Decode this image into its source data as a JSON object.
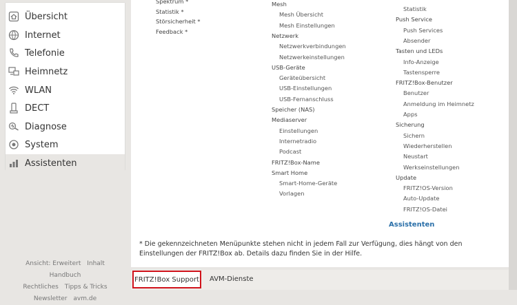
{
  "nav": {
    "items": [
      {
        "label": "Übersicht",
        "icon": "home-icon"
      },
      {
        "label": "Internet",
        "icon": "globe-icon"
      },
      {
        "label": "Telefonie",
        "icon": "phone-icon"
      },
      {
        "label": "Heimnetz",
        "icon": "network-icon"
      },
      {
        "label": "WLAN",
        "icon": "wifi-icon"
      },
      {
        "label": "DECT",
        "icon": "dect-phone-icon"
      },
      {
        "label": "Diagnose",
        "icon": "diagnose-icon"
      },
      {
        "label": "System",
        "icon": "system-icon"
      },
      {
        "label": "Assistenten",
        "icon": "wizard-icon",
        "selected": true
      }
    ]
  },
  "left_footer": {
    "ansicht": "Ansicht: Erweitert",
    "inhalt": "Inhalt",
    "handbuch": "Handbuch",
    "rechtliches": "Rechtliches",
    "tipps": "Tipps & Tricks",
    "newsletter": "Newsletter",
    "avm": "avm.de"
  },
  "sitemap": {
    "col1": [
      {
        "label": "Spektrum *",
        "sub": false
      },
      {
        "label": "Statistik *",
        "sub": false
      },
      {
        "label": "Störsicherheit *",
        "sub": false
      },
      {
        "label": "Feedback *",
        "sub": false
      }
    ],
    "col2": [
      {
        "label": "Mesh",
        "sub": false
      },
      {
        "label": "Mesh Übersicht",
        "sub": true
      },
      {
        "label": "Mesh Einstellungen",
        "sub": true
      },
      {
        "label": "Netzwerk",
        "sub": false
      },
      {
        "label": "Netzwerkverbindungen",
        "sub": true
      },
      {
        "label": "Netzwerkeinstellungen",
        "sub": true
      },
      {
        "label": "USB-Geräte",
        "sub": false
      },
      {
        "label": "Geräteübersicht",
        "sub": true
      },
      {
        "label": "USB-Einstellungen",
        "sub": true
      },
      {
        "label": "USB-Fernanschluss",
        "sub": true
      },
      {
        "label": "Speicher (NAS)",
        "sub": false
      },
      {
        "label": "Mediaserver",
        "sub": false
      },
      {
        "label": "Einstellungen",
        "sub": true
      },
      {
        "label": "Internetradio",
        "sub": true
      },
      {
        "label": "Podcast",
        "sub": true
      },
      {
        "label": "FRITZ!Box-Name",
        "sub": false
      },
      {
        "label": "Smart Home",
        "sub": false
      },
      {
        "label": "Smart-Home-Geräte",
        "sub": true
      },
      {
        "label": "Vorlagen",
        "sub": true
      }
    ],
    "col3": [
      {
        "label": "Statistik",
        "sub": true
      },
      {
        "label": "Push Service",
        "sub": false
      },
      {
        "label": "Push Services",
        "sub": true
      },
      {
        "label": "Absender",
        "sub": true
      },
      {
        "label": "Tasten und LEDs",
        "sub": false
      },
      {
        "label": "Info-Anzeige",
        "sub": true
      },
      {
        "label": "Tastensperre",
        "sub": true
      },
      {
        "label": "FRITZ!Box-Benutzer",
        "sub": false
      },
      {
        "label": "Benutzer",
        "sub": true
      },
      {
        "label": "Anmeldung im Heimnetz",
        "sub": true
      },
      {
        "label": "Apps",
        "sub": true
      },
      {
        "label": "Sicherung",
        "sub": false
      },
      {
        "label": "Sichern",
        "sub": true
      },
      {
        "label": "Wiederherstellen",
        "sub": true
      },
      {
        "label": "Neustart",
        "sub": true
      },
      {
        "label": "Werkseinstellungen",
        "sub": true
      },
      {
        "label": "Update",
        "sub": false
      },
      {
        "label": "FRITZ!OS-Version",
        "sub": true
      },
      {
        "label": "Auto-Update",
        "sub": true
      },
      {
        "label": "FRITZ!OS-Datei",
        "sub": true
      }
    ]
  },
  "assistenten_heading": "Assistenten",
  "footnote": "* Die gekennzeichneten Menüpunkte stehen nicht in jedem Fall zur Verfügung, dies hängt von den Einstellungen der FRITZ!Box ab. Details dazu finden Sie in der Hilfe.",
  "bottom": {
    "support": "FRITZ!Box Support",
    "avm_dienste": "AVM-Dienste"
  },
  "colors": {
    "highlight_border": "#d0121b",
    "link_blue": "#2a6fa8"
  }
}
